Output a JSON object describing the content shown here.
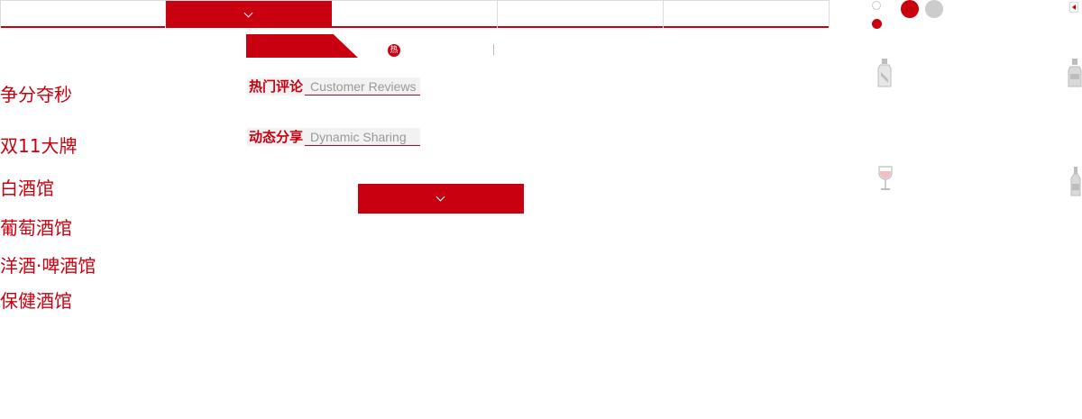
{
  "nav": {
    "tabs": [
      {
        "label": "",
        "active": false
      },
      {
        "label": "",
        "active": true
      },
      {
        "label": "",
        "active": false
      },
      {
        "label": "",
        "active": false
      },
      {
        "label": "",
        "active": false
      }
    ]
  },
  "badge": {
    "hot": "热"
  },
  "categories": [
    "争分夺秒",
    "双11大牌",
    "白酒馆",
    "葡萄酒馆",
    "洋酒·啤酒馆",
    "保健酒馆"
  ],
  "sections": {
    "reviews": {
      "cn": "热门评论",
      "en": "Customer Reviews"
    },
    "sharing": {
      "cn": "动态分享",
      "en": "Dynamic Sharing"
    }
  },
  "colors": {
    "accent": "#c9000f",
    "muted": "#cccccc",
    "border": "#dcdcdc"
  },
  "icons": [
    "arrow-left-icon",
    "spirit-bottle-icon",
    "liquor-bottle-icon",
    "wine-glass-icon",
    "wine-bottle-icon"
  ]
}
